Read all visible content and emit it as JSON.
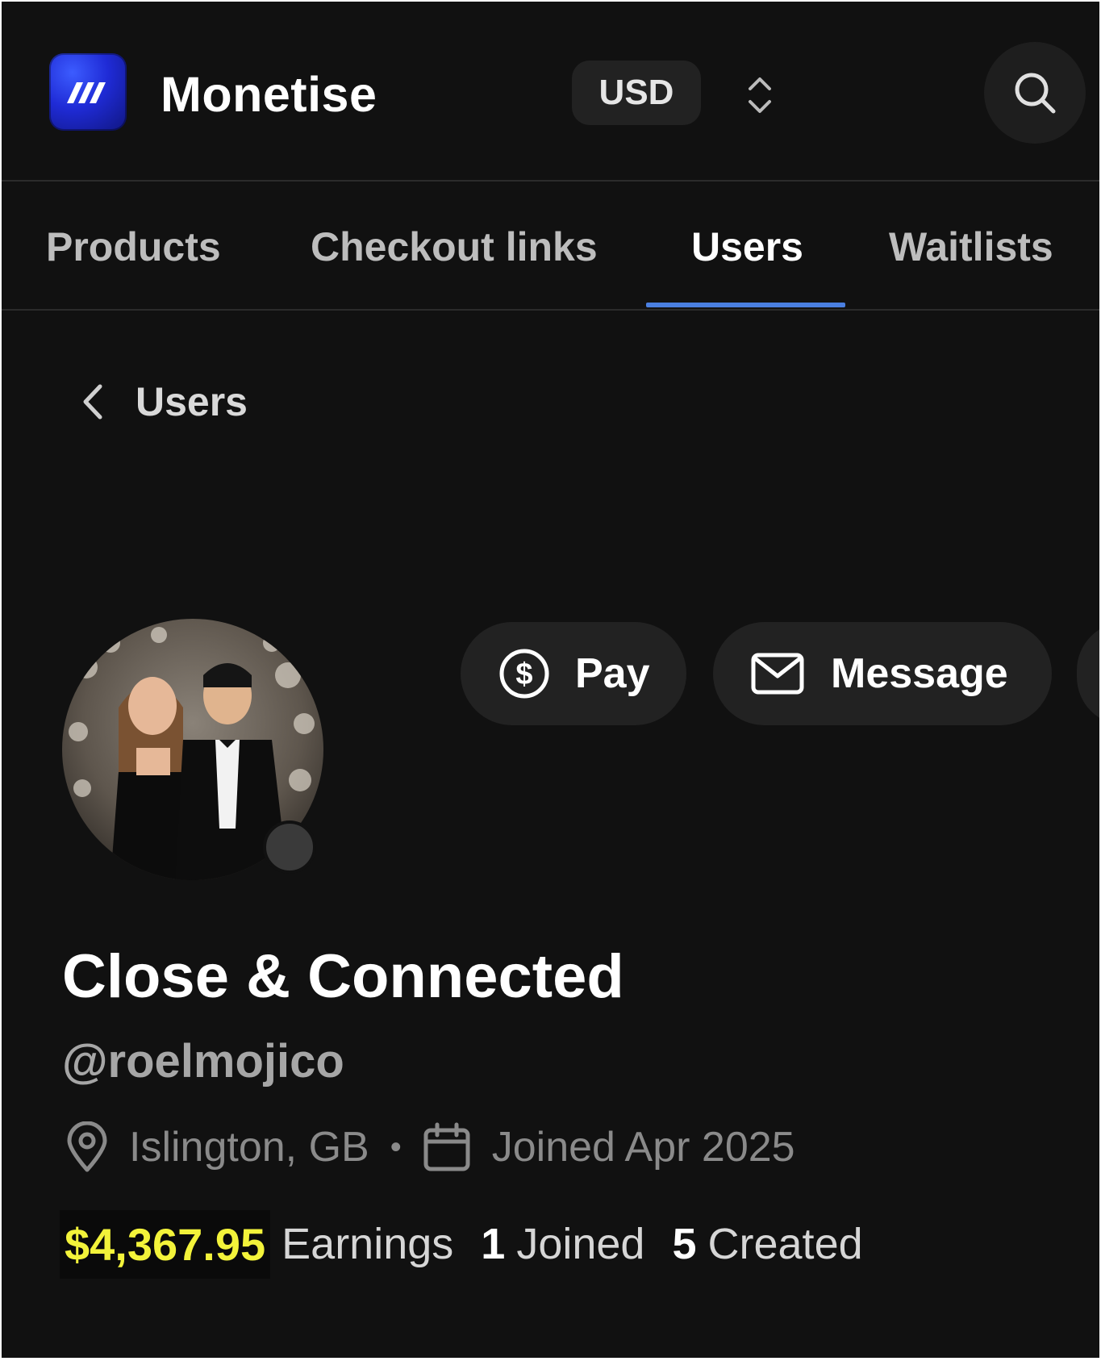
{
  "header": {
    "brand": "Monetise",
    "currency": "USD"
  },
  "tabs": [
    {
      "label": "Products",
      "active": false
    },
    {
      "label": "Checkout links",
      "active": false
    },
    {
      "label": "Users",
      "active": true
    },
    {
      "label": "Waitlists",
      "active": false
    }
  ],
  "breadcrumb": {
    "label": "Users"
  },
  "actions": {
    "pay_label": "Pay",
    "message_label": "Message"
  },
  "profile": {
    "display_name": "Close & Connected",
    "handle": "@roelmojico",
    "location": "Islington, GB",
    "separator": "•",
    "joined": "Joined Apr 2025",
    "online": false
  },
  "stats": {
    "earnings_value": "$4,367.95",
    "earnings_label": "Earnings",
    "joined_count": "1",
    "joined_label": "Joined",
    "created_count": "5",
    "created_label": "Created"
  },
  "colors": {
    "background": "#111111",
    "accent": "#4a7fe0",
    "earnings_highlight": "#f3f33a",
    "pill": "#222222"
  },
  "icons": {
    "logo": "monetise-logo-icon",
    "stepper": "chevron-up-down-icon",
    "search": "search-icon",
    "back": "chevron-left-icon",
    "pay": "dollar-circle-icon",
    "message": "mail-icon",
    "location": "map-pin-icon",
    "calendar": "calendar-icon"
  }
}
